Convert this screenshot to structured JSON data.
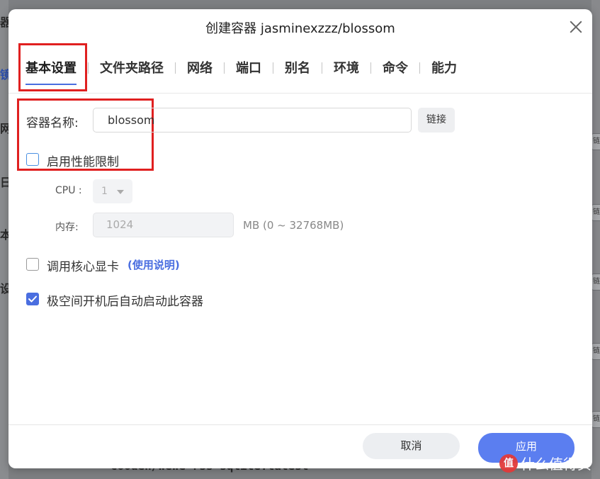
{
  "background": {
    "left_chars": [
      "器",
      "镜",
      "网",
      "日",
      "本",
      "设"
    ],
    "right_tab_label": "链接",
    "bottom_text": "cooden/wewe-rss-sqlite:latest"
  },
  "dialog": {
    "title": "创建容器 jasminexzzz/blossom",
    "tabs": [
      "基本设置",
      "文件夹路径",
      "网络",
      "端口",
      "别名",
      "环境",
      "命令",
      "能力"
    ],
    "active_tab": 0,
    "name_label": "容器名称:",
    "name_value": "blossom",
    "link_button": "链接",
    "perf_limit_label": "启用性能限制",
    "perf_limit_checked": false,
    "cpu_label": "CPU :",
    "cpu_value": "1",
    "mem_label": "内存:",
    "mem_value": "1024",
    "mem_hint": "MB (0 ~ 32768MB)",
    "gpu_label": "调用核心显卡",
    "gpu_help": "(使用说明)",
    "gpu_checked": false,
    "autostart_label": "极空间开机后自动启动此容器",
    "autostart_checked": true,
    "cancel_button": "取消",
    "apply_button": "应用"
  },
  "watermark": {
    "logo_char": "值",
    "text": "什么值得买"
  },
  "colors": {
    "accent": "#4a6ee0",
    "apply_bg": "#5b7ef0",
    "highlight_red": "#e02020"
  }
}
